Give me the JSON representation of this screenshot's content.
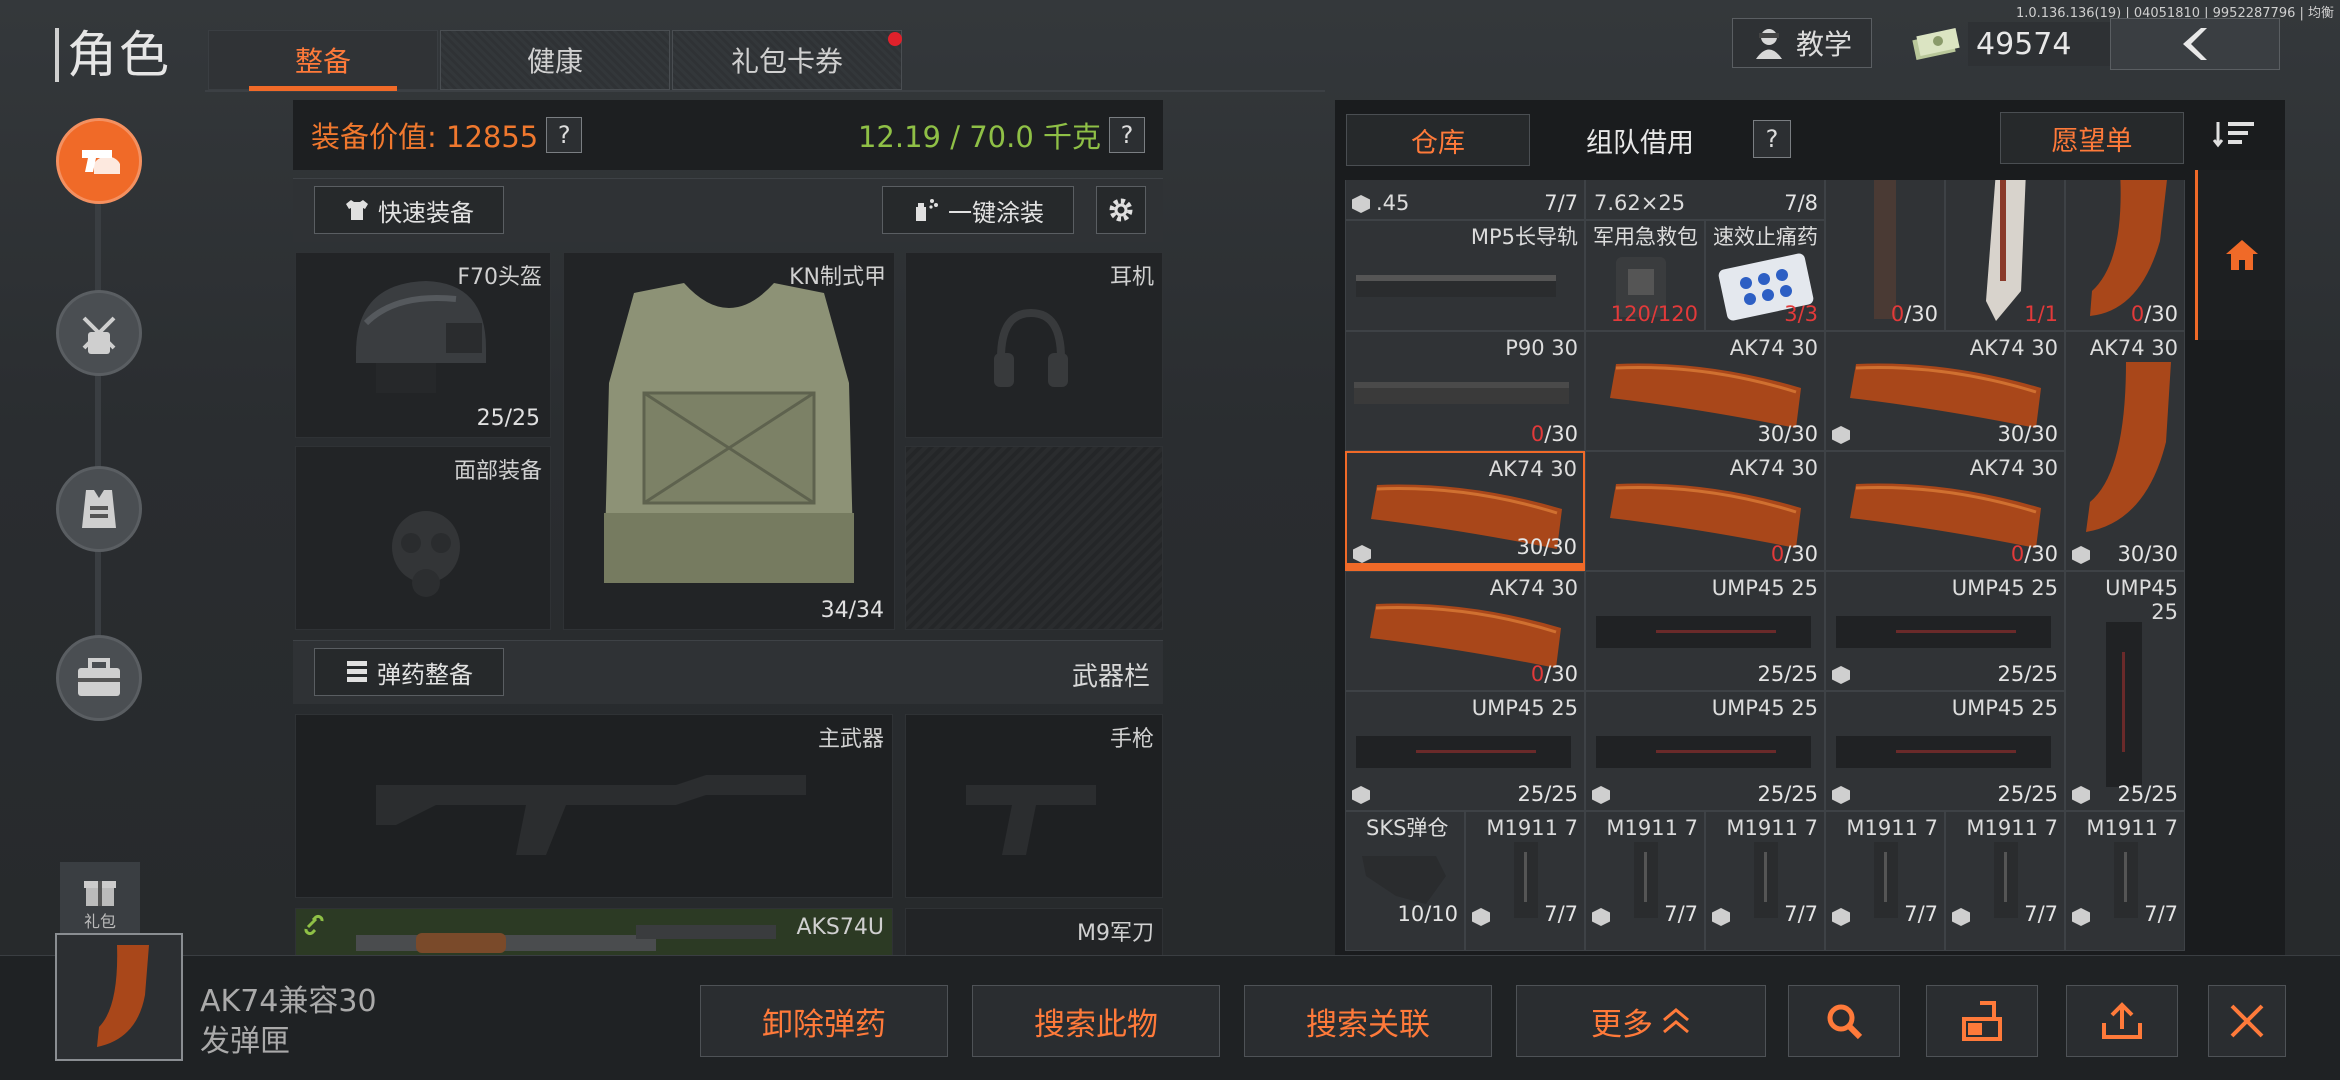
{
  "version": "1.0.136.136(19) | 04051810 | 9952287796 | 均衡",
  "page_title": "角色",
  "tabs": [
    {
      "label": "整备"
    },
    {
      "label": "健康"
    },
    {
      "label": "礼包卡券"
    }
  ],
  "top": {
    "teach_label": "教学",
    "money": "49574"
  },
  "rail": {
    "gift_label": "礼包"
  },
  "equip": {
    "value_label": "装备价值: 12855",
    "weight": "12.19 / 70.0 千克",
    "help": "?",
    "quick_equip": "快速装备",
    "paint": "一键涂装",
    "ammo_prep": "弹药整备",
    "weapon_bar": "武器栏",
    "slots": {
      "helmet": {
        "label": "F70头盔",
        "dur": "25/25"
      },
      "armor": {
        "label": "KN制式甲",
        "dur": "34/34"
      },
      "headset": {
        "label": "耳机"
      },
      "face": {
        "label": "面部装备"
      },
      "primary": {
        "label": "主武器"
      },
      "pistol": {
        "label": "手枪"
      },
      "secondary": {
        "label": "AKS74U"
      },
      "melee": {
        "label": "M9军刀"
      }
    }
  },
  "storage": {
    "tab_warehouse": "仓库",
    "tab_team": "组队借用",
    "wishlist": "愿望单",
    "help": "?",
    "cells": {
      "c45": {
        "name": ".45",
        "count": "7/7"
      },
      "c762": {
        "name": "7.62×25",
        "count": "7/8"
      },
      "mag1": {
        "count_cur": "0",
        "count_max": "/30"
      },
      "knife": {
        "count": "1/1"
      },
      "mag2": {
        "count_cur": "0",
        "count_max": "/30"
      },
      "mp5rail": {
        "name": "MP5长导轨"
      },
      "medkit": {
        "name": "军用急救包",
        "count": "120/120"
      },
      "pills": {
        "name": "速效止痛药",
        "count": "3/3"
      },
      "p90": {
        "name": "P90 30",
        "count_cur": "0",
        "count_max": "/30"
      },
      "ak_a": {
        "name": "AK74 30",
        "count": "30/30"
      },
      "ak_b": {
        "name": "AK74 30",
        "count": "30/30"
      },
      "ak_c": {
        "name": "AK74 30"
      },
      "ak_d": {
        "name": "AK74 30",
        "count": "30/30"
      },
      "ak_e": {
        "name": "AK74 30",
        "count_cur": "0",
        "count_max": "/30"
      },
      "ak_f": {
        "name": "AK74 30",
        "count_cur": "0",
        "count_max": "/30"
      },
      "ak_g": {
        "count": "30/30"
      },
      "ak_h": {
        "name": "AK74 30",
        "count_cur": "0",
        "count_max": "/30"
      },
      "ump_a": {
        "name": "UMP45 25",
        "count": "25/25"
      },
      "ump_b": {
        "name": "UMP45 25",
        "count": "25/25"
      },
      "ump_c": {
        "name": "UMP45\n25"
      },
      "ump_d": {
        "name": "UMP45 25",
        "count": "25/25"
      },
      "ump_e": {
        "name": "UMP45 25",
        "count": "25/25"
      },
      "ump_f": {
        "name": "UMP45 25",
        "count": "25/25"
      },
      "ump_g": {
        "count": "25/25"
      },
      "sks": {
        "name": "SKS弹仓",
        "count": "10/10"
      },
      "m1911": [
        {
          "name": "M1911 7",
          "count": "7/7"
        },
        {
          "name": "M1911 7",
          "count": "7/7"
        },
        {
          "name": "M1911 7",
          "count": "7/7"
        },
        {
          "name": "M1911 7",
          "count": "7/7"
        },
        {
          "name": "M1911 7",
          "count": "7/7"
        },
        {
          "name": "M1911 7",
          "count": "7/7"
        }
      ]
    }
  },
  "bottom": {
    "selected_name_1": "AK74兼容30",
    "selected_name_2": "发弹匣",
    "btn_unload": "卸除弹药",
    "btn_search_item": "搜索此物",
    "btn_search_related": "搜索关联",
    "btn_more": "更多"
  },
  "colors": {
    "accent": "#f06a28",
    "weight_green": "#8fc046",
    "zero_red": "#e23a3a"
  }
}
